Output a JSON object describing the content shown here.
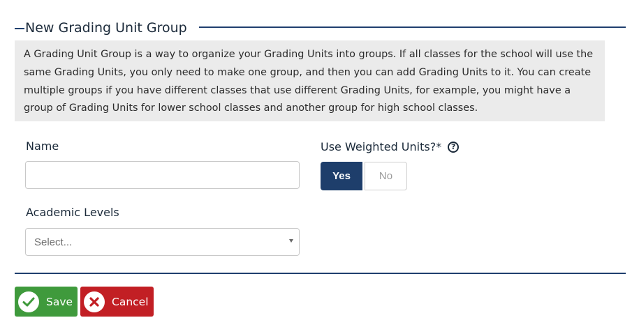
{
  "form": {
    "title": "New Grading Unit Group",
    "description": "A Grading Unit Group is a way to organize your Grading Units into groups. If all classes for the school will use the same Grading Units, you only need to make one group, and then you can add Grading Units to it. You can create multiple groups if you have different classes that use different Grading Units, for example, you might have a group of Grading Units for lower school classes and another group for high school classes."
  },
  "fields": {
    "name": {
      "label": "Name",
      "value": "",
      "placeholder": ""
    },
    "academic_levels": {
      "label": "Academic Levels",
      "placeholder": "Select..."
    },
    "use_weighted": {
      "label": "Use Weighted Units?*",
      "help_icon": "question-circle-icon",
      "yes_label": "Yes",
      "no_label": "No",
      "selected": "Yes"
    }
  },
  "actions": {
    "save_label": "Save",
    "cancel_label": "Cancel"
  },
  "colors": {
    "primary": "#1e3e6b",
    "save": "#3f9a3c",
    "cancel": "#c21f24",
    "info_bg": "#ebebeb"
  }
}
